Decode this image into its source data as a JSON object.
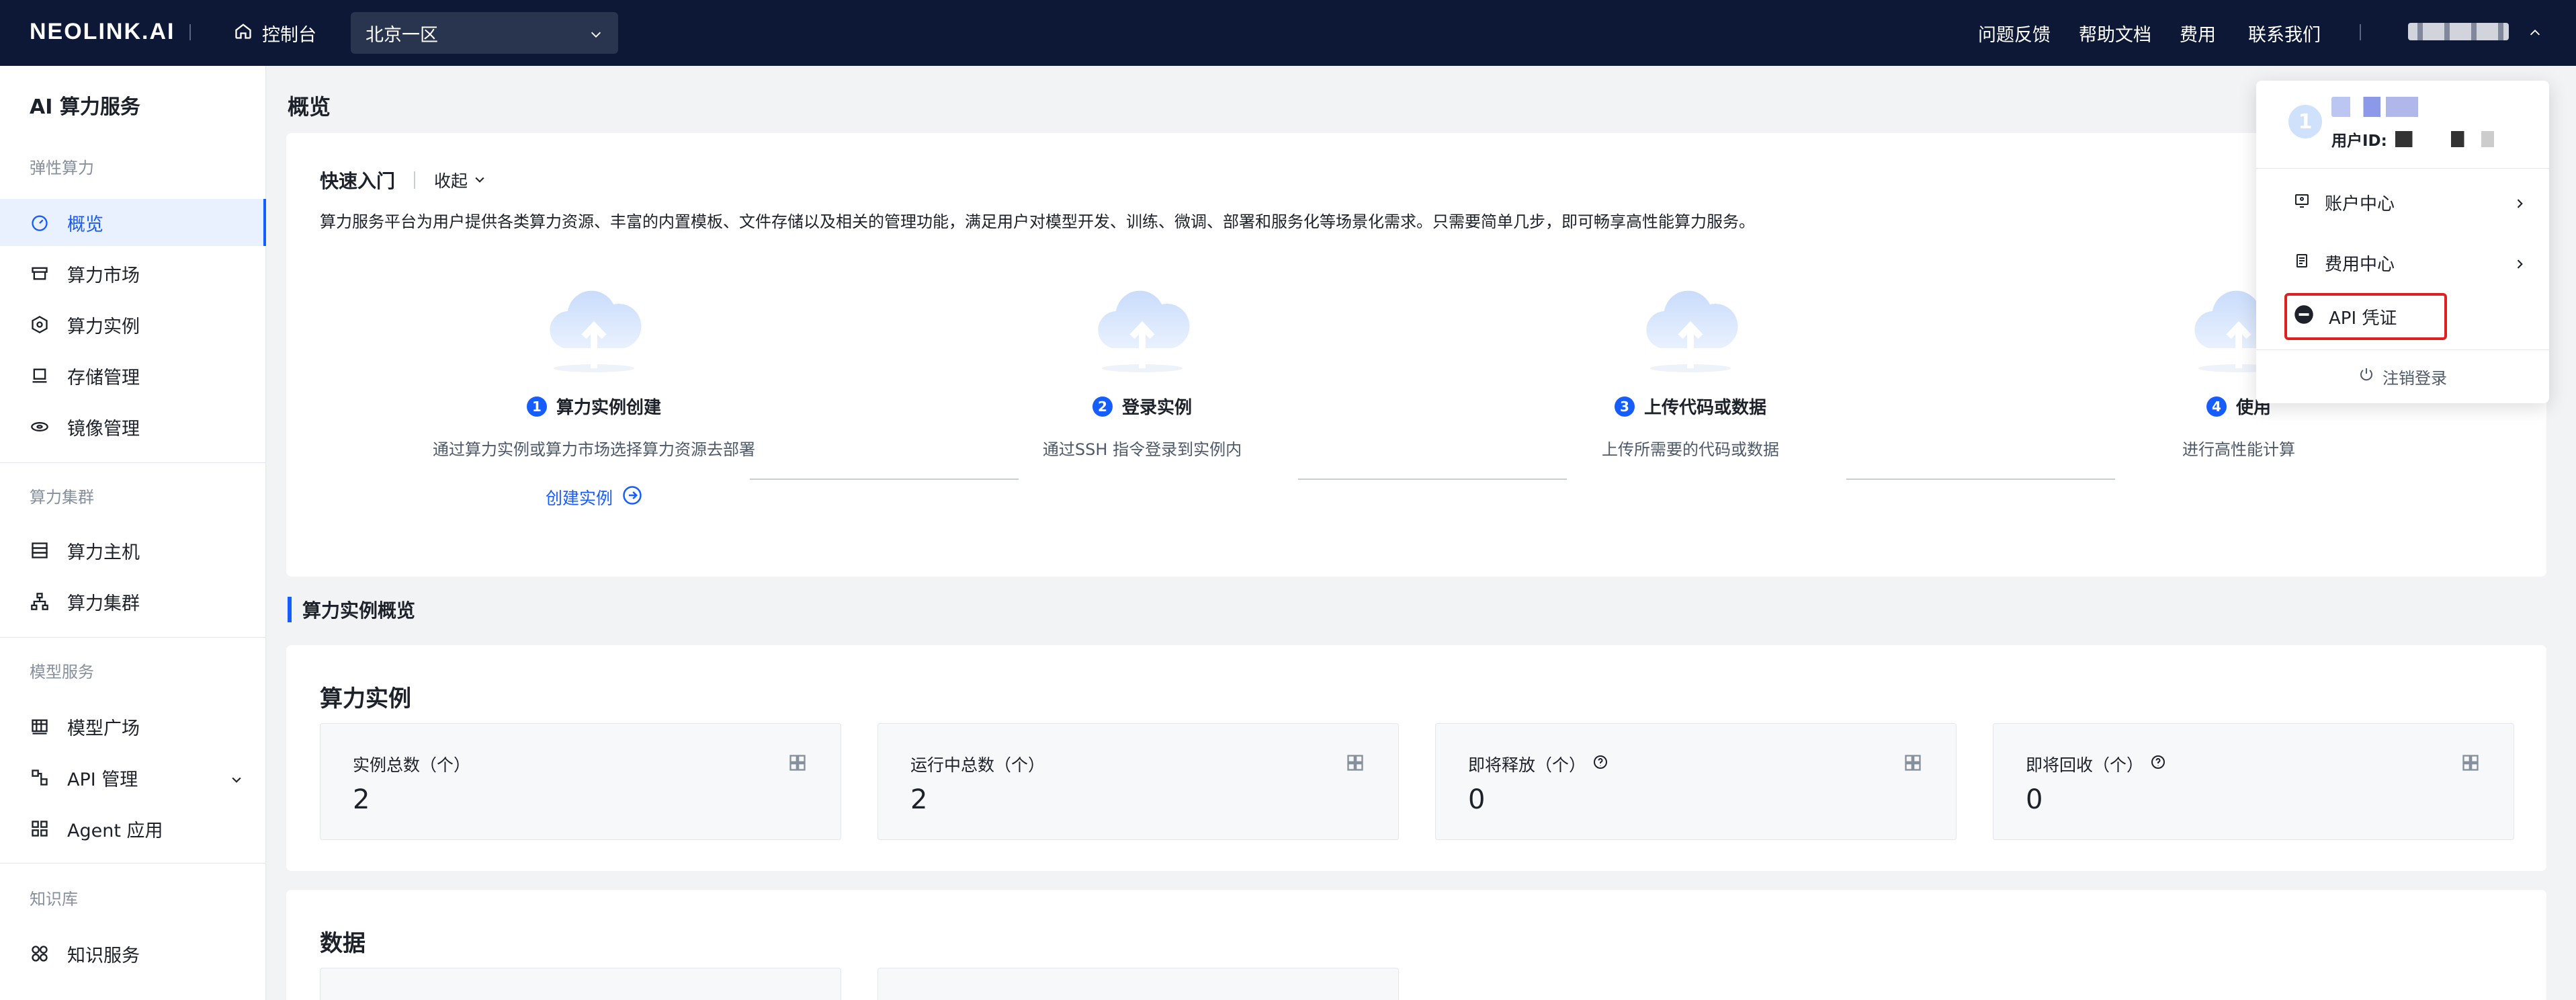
{
  "topbar": {
    "logo": "NEOLINK.AI",
    "console_label": "控制台",
    "region": "北京一区",
    "links": [
      "问题反馈",
      "帮助文档",
      "费用",
      "联系我们"
    ]
  },
  "sidebar": {
    "title": "AI 算力服务",
    "groups": [
      {
        "label": "弹性算力",
        "items": [
          "概览",
          "算力市场",
          "算力实例",
          "存储管理",
          "镜像管理"
        ]
      },
      {
        "label": "算力集群",
        "items": [
          "算力主机",
          "算力集群"
        ]
      },
      {
        "label": "模型服务",
        "items": [
          "模型广场",
          "API 管理",
          "Agent 应用"
        ]
      },
      {
        "label": "知识库",
        "items": [
          "知识服务"
        ]
      }
    ],
    "active": "概览"
  },
  "main": {
    "page_title": "概览",
    "quickstart": {
      "title": "快速入门",
      "collapse_label": "收起",
      "description": "算力服务平台为用户提供各类算力资源、丰富的内置模板、文件存储以及相关的管理功能，满足用户对模型开发、训练、微调、部署和服务化等场景化需求。只需要简单几步，即可畅享高性能算力服务。",
      "steps": [
        {
          "num": "1",
          "title": "算力实例创建",
          "desc": "通过算力实例或算力市场选择算力资源去部署",
          "link": "创建实例"
        },
        {
          "num": "2",
          "title": "登录实例",
          "desc": "通过SSH 指令登录到实例内"
        },
        {
          "num": "3",
          "title": "上传代码或数据",
          "desc": "上传所需要的代码或数据"
        },
        {
          "num": "4",
          "title": "使用",
          "desc": "进行高性能计算"
        }
      ]
    },
    "overview_section": "算力实例概览",
    "instances": {
      "title": "算力实例",
      "stats": [
        {
          "label": "实例总数（个）",
          "value": "2"
        },
        {
          "label": "运行中总数（个）",
          "value": "2"
        },
        {
          "label": "即将释放（个）",
          "value": "0"
        },
        {
          "label": "即将回收（个）",
          "value": "0"
        }
      ]
    },
    "data": {
      "title": "数据"
    }
  },
  "user_menu": {
    "avatar": "1",
    "uid_label": "用户ID:",
    "items": [
      "账户中心",
      "费用中心",
      "API 凭证"
    ],
    "logout": "注销登录"
  },
  "colors": {
    "topbar": "#0d1836",
    "accent": "#165dff",
    "highlight": "#e02020"
  }
}
